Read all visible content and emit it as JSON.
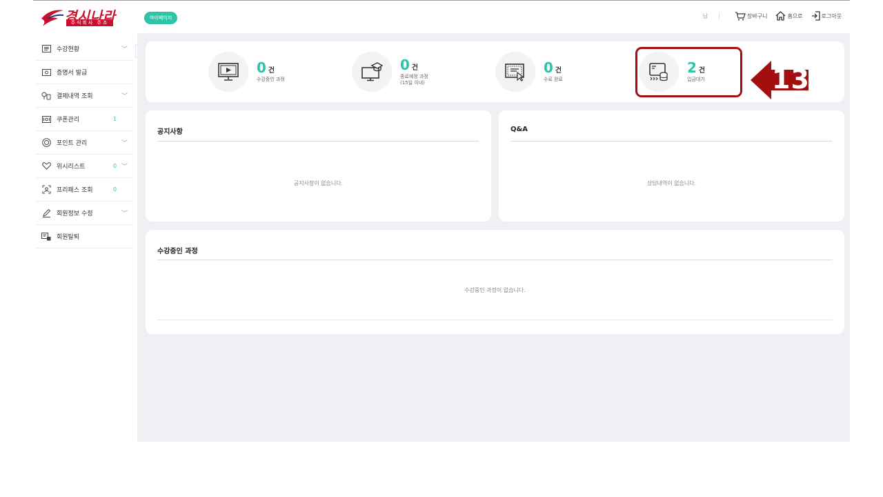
{
  "header": {
    "logo_main": "경시나라",
    "logo_sub": "주식회사 주조",
    "mypage_label": "마이페이지",
    "user_suffix": "님",
    "links": [
      {
        "label": "장바구니",
        "icon": "cart-icon"
      },
      {
        "label": "홈으로",
        "icon": "home-icon"
      },
      {
        "label": "로그아웃",
        "icon": "logout-icon"
      }
    ]
  },
  "sidebar": {
    "collapse_symbol": "«",
    "items": [
      {
        "label": "수강현황",
        "icon": "list-icon",
        "count": "",
        "has_chevron": true
      },
      {
        "label": "증명서 발급",
        "icon": "certificate-icon",
        "count": "",
        "has_chevron": false
      },
      {
        "label": "결제내역 조회",
        "icon": "payment-icon",
        "count": "",
        "has_chevron": true
      },
      {
        "label": "쿠폰관리",
        "icon": "coupon-icon",
        "count": "1",
        "has_chevron": false
      },
      {
        "label": "포인트 관리",
        "icon": "point-icon",
        "count": "",
        "has_chevron": true
      },
      {
        "label": "위시리스트",
        "icon": "heart-icon",
        "count": "0",
        "has_chevron": true
      },
      {
        "label": "프리패스 조회",
        "icon": "freepass-icon",
        "count": "0",
        "has_chevron": false
      },
      {
        "label": "회원정보 수정",
        "icon": "edit-icon",
        "count": "",
        "has_chevron": true
      },
      {
        "label": "회원탈퇴",
        "icon": "withdraw-icon",
        "count": "",
        "has_chevron": false
      }
    ]
  },
  "stats": [
    {
      "num": "0",
      "unit": "건",
      "desc": "수강중인 과정",
      "icon": "monitor-play-icon"
    },
    {
      "num": "0",
      "unit": "건",
      "desc": "종료예정 과정\n(15일 이내)",
      "icon": "graduation-monitor-icon"
    },
    {
      "num": "0",
      "unit": "건",
      "desc": "수료 완료",
      "icon": "certificate-cursor-icon"
    },
    {
      "num": "2",
      "unit": "건",
      "desc": "입금대기",
      "icon": "card-coins-icon"
    }
  ],
  "annotation": {
    "label": "13",
    "color": "#a30f0f"
  },
  "notice": {
    "title": "공지사항",
    "empty": "공지사항이 없습니다."
  },
  "qna": {
    "title": "Q&A",
    "empty": "상담내역이 없습니다."
  },
  "courses": {
    "title": "수강중인 과정",
    "empty": "수강중인 과정이 없습니다."
  },
  "colors": {
    "accent": "#2ec4a7",
    "brand": "#c8102e",
    "background": "#eef0f4"
  }
}
